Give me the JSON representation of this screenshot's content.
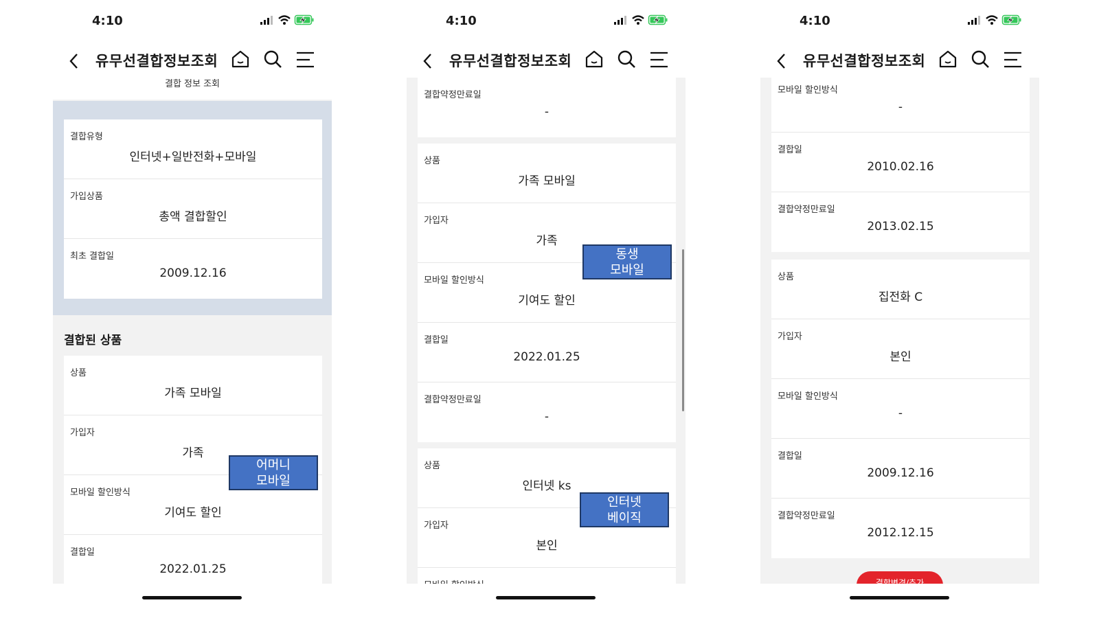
{
  "status_bar": {
    "time": "4:10"
  },
  "nav": {
    "title": "유무선결합정보조회"
  },
  "screen1": {
    "sub_title": "결합 정보 조회",
    "summary": [
      {
        "label": "결합유형",
        "value": "인터넷+일반전화+모바일"
      },
      {
        "label": "가입상품",
        "value": "총액 결합할인"
      },
      {
        "label": "최초 결합일",
        "value": "2009.12.16"
      }
    ],
    "section_title": "결합된 상품",
    "product": [
      {
        "label": "상품",
        "value": "가족 모바일"
      },
      {
        "label": "가입자",
        "value": "가족"
      },
      {
        "label": "모바일 할인방식",
        "value": "기여도 할인"
      },
      {
        "label": "결합일",
        "value": "2022.01.25"
      }
    ],
    "annotation": {
      "line1": "어머니",
      "line2": "모바일"
    }
  },
  "screen2": {
    "card_a": [
      {
        "label": "결합약정만료일",
        "value": "-"
      }
    ],
    "card_b": [
      {
        "label": "상품",
        "value": "가족 모바일"
      },
      {
        "label": "가입자",
        "value": "가족"
      },
      {
        "label": "모바일 할인방식",
        "value": "기여도 할인"
      },
      {
        "label": "결합일",
        "value": "2022.01.25"
      },
      {
        "label": "결합약정만료일",
        "value": "-"
      }
    ],
    "card_c": [
      {
        "label": "상품",
        "value": "인터넷 ks"
      },
      {
        "label": "가입자",
        "value": "본인"
      },
      {
        "label": "모바일 할인방식",
        "value": ""
      }
    ],
    "annotation_1": {
      "line1": "동생",
      "line2": "모바일"
    },
    "annotation_2": {
      "line1": "인터넷",
      "line2": "베이직"
    }
  },
  "screen3": {
    "card_a": [
      {
        "label": "모바일 할인방식",
        "value": "-"
      },
      {
        "label": "결합일",
        "value": "2010.02.16"
      },
      {
        "label": "결합약정만료일",
        "value": "2013.02.15"
      }
    ],
    "card_b": [
      {
        "label": "상품",
        "value": "집전화 C"
      },
      {
        "label": "가입자",
        "value": "본인"
      },
      {
        "label": "모바일 할인방식",
        "value": "-"
      },
      {
        "label": "결합일",
        "value": "2009.12.16"
      },
      {
        "label": "결합약정만료일",
        "value": "2012.12.15"
      }
    ],
    "cta_label": "결합변경/추가"
  },
  "colors": {
    "accent_red": "#e3242b",
    "annotation_blue": "#4472c4",
    "summary_bg": "#d5dde8",
    "battery_green": "#34c759"
  },
  "icons": [
    "back-arrow-icon",
    "home-icon",
    "search-icon",
    "menu-icon",
    "signal-icon",
    "wifi-icon",
    "battery-charging-icon"
  ]
}
